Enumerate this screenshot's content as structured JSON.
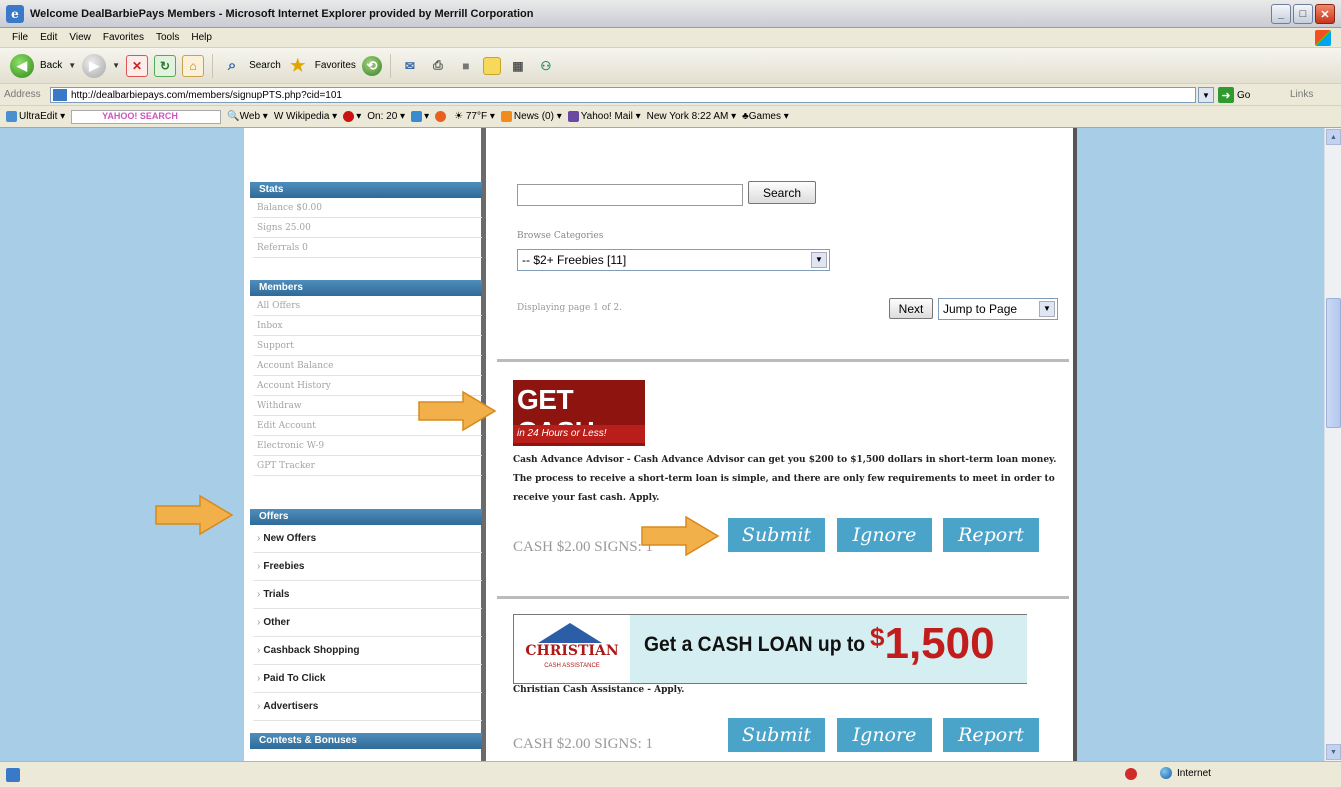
{
  "window": {
    "title": "Welcome DealBarbiePays Members - Microsoft Internet Explorer provided by Merrill Corporation",
    "minimize": "_",
    "maximize": "□",
    "close": "✕"
  },
  "menu": [
    "File",
    "Edit",
    "View",
    "Favorites",
    "Tools",
    "Help"
  ],
  "toolbar": {
    "back_label": "Back",
    "search_label": "Search",
    "favorites_label": "Favorites"
  },
  "address": {
    "label": "Address",
    "url": "http://dealbarbiepays.com/members/signupPTS.php?cid=101",
    "go_label": "Go",
    "links_label": "Links"
  },
  "linksbar": {
    "ultraedit": "UltraEdit",
    "yahoo": "YAHOO! SEARCH",
    "web": "Web",
    "wikipedia": "Wikipedia",
    "on": "On: 20",
    "temp": "77°F",
    "news": "News (0)",
    "mail": "Yahoo! Mail",
    "time": "New York 8:22 AM",
    "games": "Games"
  },
  "sidebar": {
    "stats": {
      "heading": "Stats",
      "items": [
        "Balance $0.00",
        "Signs 25.00",
        "Referrals 0"
      ]
    },
    "members": {
      "heading": "Members",
      "items": [
        "All Offers",
        "Inbox",
        "Support",
        "Account Balance",
        "Account History",
        "Withdraw",
        "Edit Account",
        "Electronic W-9",
        "GPT Tracker"
      ]
    },
    "offers": {
      "heading": "Offers",
      "items": [
        "New Offers",
        "Freebies",
        "Trials",
        "Other",
        "Cashback Shopping",
        "Paid To Click",
        "Advertisers"
      ]
    },
    "contests": {
      "heading": "Contests & Bonuses"
    }
  },
  "main": {
    "search_button": "Search",
    "browse_label": "Browse Categories",
    "category_selected": "-- $2+ Freebies [11]",
    "paging_text": "Displaying page 1 of 2.",
    "next_button": "Next",
    "jump_select": "Jump to Page",
    "offers": [
      {
        "banner_title": "GET CASH",
        "banner_sub": "in 24 Hours or Less!",
        "description": "Cash Advance Advisor - Cash Advance Advisor can get you $200 to $1,500 dollars in short-term loan money. The process to receive a short-term loan is simple, and there are only few requirements to meet in order to receive your fast cash. Apply.",
        "meta": "CASH $2.00   SIGNS: 1",
        "buttons": [
          "Submit",
          "Ignore",
          "Report"
        ]
      },
      {
        "banner_logo": "CHRISTIAN",
        "banner_logo_sub": "CASH ASSISTANCE",
        "banner_text": "Get a CASH LOAN up to",
        "banner_amount": "1,500",
        "banner_currency": "$",
        "description": "Christian Cash Assistance - Apply.",
        "meta": "CASH $2.00   SIGNS: 1",
        "buttons": [
          "Submit",
          "Ignore",
          "Report"
        ]
      }
    ]
  },
  "status": {
    "zone": "Internet"
  },
  "colors": {
    "page_background": "#a8cde6",
    "sidebar_heading": "#2f6b98",
    "action_button": "#4aa3c9",
    "arrow": "#f2b04a"
  }
}
